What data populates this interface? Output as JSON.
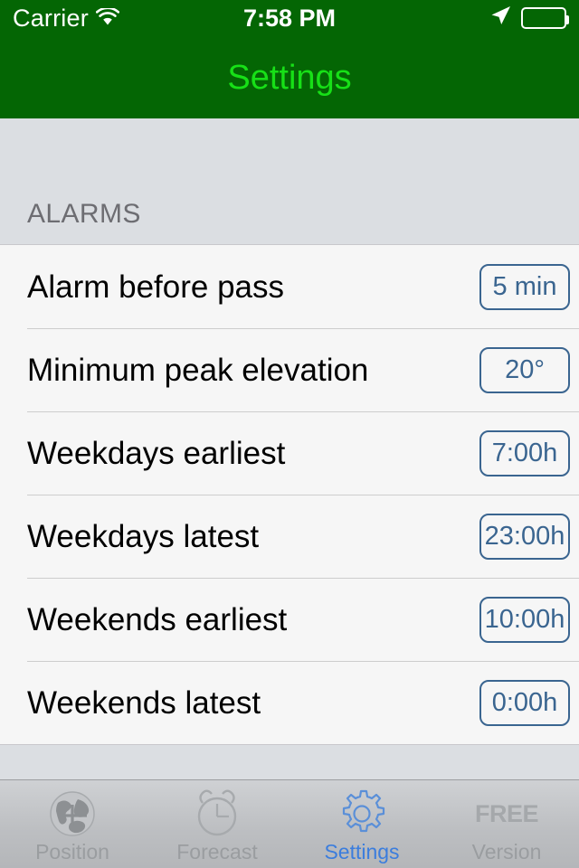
{
  "status_bar": {
    "carrier": "Carrier",
    "wifi_icon": "wifi-icon",
    "time": "7:58 PM",
    "location_icon": "location-arrow-icon",
    "battery_icon": "battery-icon"
  },
  "nav_bar": {
    "title": "Settings",
    "background_color": "#046604",
    "title_color": "#17e017"
  },
  "sections": [
    {
      "header": "ALARMS",
      "rows": [
        {
          "label": "Alarm before pass",
          "value": "5 min"
        },
        {
          "label": "Minimum peak elevation",
          "value": "20°"
        },
        {
          "label": "Weekdays earliest",
          "value": "7:00h"
        },
        {
          "label": "Weekdays latest",
          "value": "23:00h"
        },
        {
          "label": "Weekends earliest",
          "value": "10:00h"
        },
        {
          "label": "Weekends latest",
          "value": "0:00h"
        }
      ]
    }
  ],
  "value_box": {
    "border_color": "#3a6590",
    "text_color": "#3a6590"
  },
  "tab_bar": {
    "active_color": "#3b7ddd",
    "inactive_color": "#9a9da0",
    "tabs": [
      {
        "label": "Position",
        "icon": "globe-crosshair-icon",
        "active": false
      },
      {
        "label": "Forecast",
        "icon": "alarm-clock-icon",
        "active": false
      },
      {
        "label": "Settings",
        "icon": "gear-icon",
        "active": true
      },
      {
        "label": "Version",
        "icon": "free-text-icon",
        "active": false,
        "icon_text": "FREE"
      }
    ]
  }
}
